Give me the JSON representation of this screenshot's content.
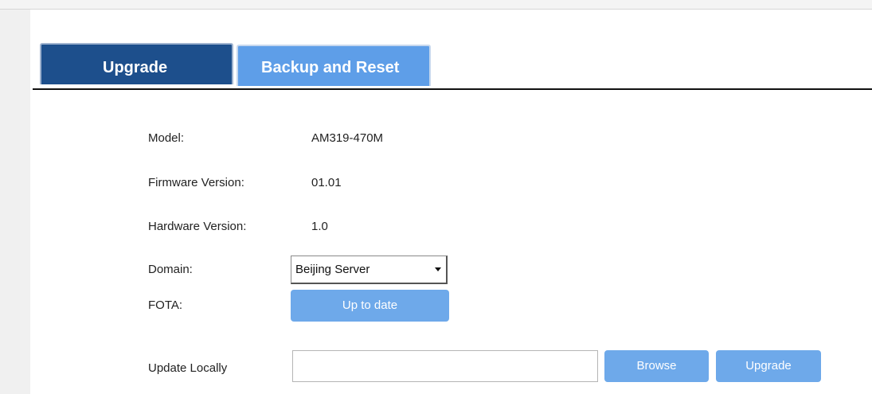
{
  "tabs": {
    "upgrade": "Upgrade",
    "backup_reset": "Backup and Reset"
  },
  "device": {
    "model_label": "Model:",
    "model_value": "AM319-470M",
    "firmware_label": "Firmware Version:",
    "firmware_value": "01.01",
    "hardware_label": "Hardware Version:",
    "hardware_value": "1.0",
    "domain_label": "Domain:",
    "domain_value": "Beijing Server",
    "fota_label": "FOTA:",
    "fota_button": "Up to date",
    "update_label": "Update Locally",
    "file_value": "",
    "browse_button": "Browse",
    "upgrade_button": "Upgrade"
  },
  "colors": {
    "active_tab": "#1d4f8c",
    "inactive_tab": "#5e9ee8",
    "button": "#6ea9ea"
  },
  "icons": {
    "select_arrow": "chevron-down-icon"
  }
}
